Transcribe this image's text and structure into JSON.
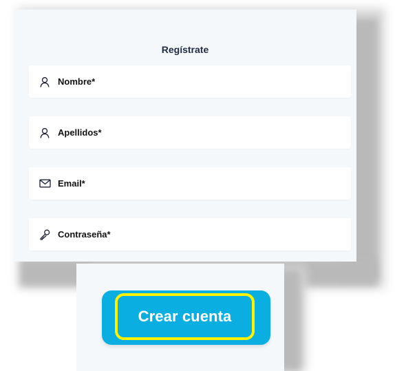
{
  "title": "Regístrate",
  "fields": [
    {
      "icon": "user-icon",
      "label": "Nombre*"
    },
    {
      "icon": "user-icon",
      "label": "Apellidos*"
    },
    {
      "icon": "mail-icon",
      "label": "Email*"
    },
    {
      "icon": "key-icon",
      "label": "Contraseña*"
    }
  ],
  "button": {
    "label": "Crear cuenta",
    "background_color": "#0aaee0",
    "highlight_color": "#fff200"
  },
  "colors": {
    "panel": "#f5f8fb",
    "text": "#111111",
    "title": "#1f2a44"
  }
}
